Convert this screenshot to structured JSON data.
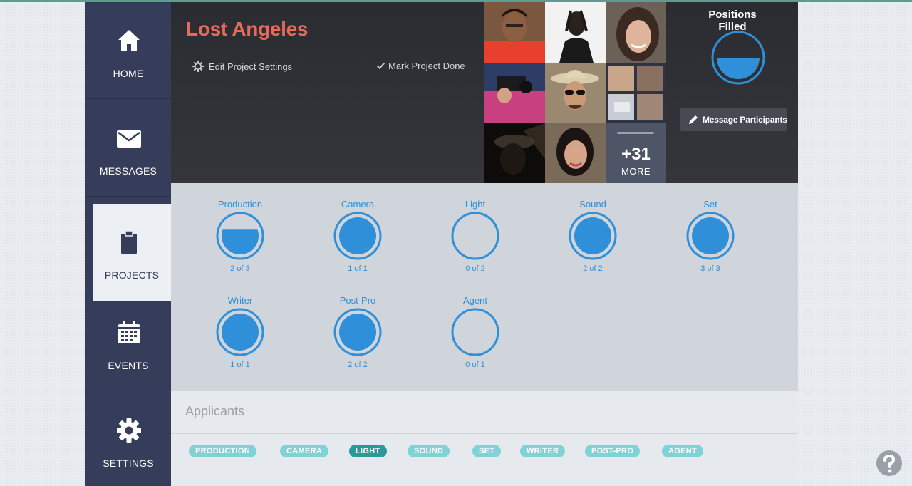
{
  "sidebar": {
    "items": [
      {
        "label": "HOME",
        "icon": "home-icon"
      },
      {
        "label": "MESSAGES",
        "icon": "envelope-icon"
      },
      {
        "label": "PROJECTS",
        "icon": "clipboard-icon",
        "active": true
      },
      {
        "label": "EVENTS",
        "icon": "calendar-icon"
      },
      {
        "label": "SETTINGS",
        "icon": "gear-icon"
      }
    ]
  },
  "project": {
    "title": "Lost Angeles",
    "edit_settings_label": "Edit Project Settings",
    "mark_done_label": "Mark Project Done",
    "more_count": "+31",
    "more_label": "MORE",
    "positions_filled_label": "Positions Filled",
    "positions_filled_fraction": 0.5,
    "message_participants_label": "Message Participants"
  },
  "positions": [
    {
      "name": "Production",
      "count": "2 of 3",
      "filled": 2,
      "total": 3
    },
    {
      "name": "Camera",
      "count": "1 of 1",
      "filled": 1,
      "total": 1
    },
    {
      "name": "Light",
      "count": "0 of 2",
      "filled": 0,
      "total": 2
    },
    {
      "name": "Sound",
      "count": "2 of 2",
      "filled": 2,
      "total": 2
    },
    {
      "name": "Set",
      "count": "3 of 3",
      "filled": 3,
      "total": 3
    },
    {
      "name": "Writer",
      "count": "1 of 1",
      "filled": 1,
      "total": 1
    },
    {
      "name": "Post-Pro",
      "count": "2 of 2",
      "filled": 2,
      "total": 2
    },
    {
      "name": "Agent",
      "count": "0 of 1",
      "filled": 0,
      "total": 1
    }
  ],
  "applicants": {
    "title": "Applicants",
    "tags": [
      {
        "label": "PRODUCTION",
        "active": false
      },
      {
        "label": "CAMERA",
        "active": false
      },
      {
        "label": "LIGHT",
        "active": true
      },
      {
        "label": "SOUND",
        "active": false
      },
      {
        "label": "SET",
        "active": false
      },
      {
        "label": "WRITER",
        "active": false
      },
      {
        "label": "POST-PRO",
        "active": false
      },
      {
        "label": "AGENT",
        "active": false
      }
    ]
  },
  "colors": {
    "sidebar": "#363d5a",
    "title": "#e8685a",
    "gauge_blue": "#2f8fd8",
    "tag": "#7fd2d6",
    "tag_active": "#2a9a98"
  }
}
